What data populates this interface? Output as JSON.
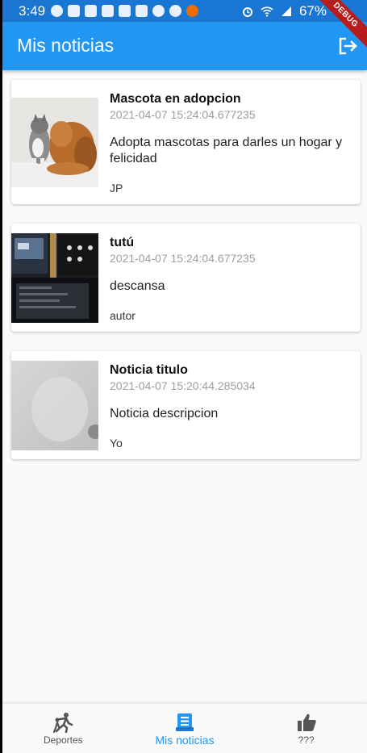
{
  "status_bar": {
    "time": "3:49",
    "battery": "67%",
    "debug_label": "DEBUG"
  },
  "app_bar": {
    "title": "Mis noticias",
    "logout_icon": "logout-icon"
  },
  "news": [
    {
      "title": "Mascota en adopcion",
      "date": "2021-04-07 15:24:04.677235",
      "description": "Adopta mascotas para darles un hogar y felicidad",
      "author": "JP",
      "image": "dog-and-cat-photo"
    },
    {
      "title": "tutú",
      "date": "2021-04-07 15:24:04.677235",
      "description": "descansa",
      "author": "autor",
      "image": "computer-desk-photo"
    },
    {
      "title": "Noticia titulo",
      "date": "2021-04-07 15:20:44.285034",
      "description": "Noticia descripcion",
      "author": "Yo",
      "image": "white-wall-photo"
    }
  ],
  "bottom_nav": {
    "items": [
      {
        "label": "Deportes",
        "icon": "sports-icon",
        "active": false
      },
      {
        "label": "Mis noticias",
        "icon": "newspaper-icon",
        "active": true
      },
      {
        "label": "???",
        "icon": "thumb-up-icon",
        "active": false
      }
    ]
  },
  "colors": {
    "primary": "#2196f3",
    "status_bar": "#1976d2",
    "background": "#fafafa",
    "debug_banner": "#b71c1c"
  }
}
